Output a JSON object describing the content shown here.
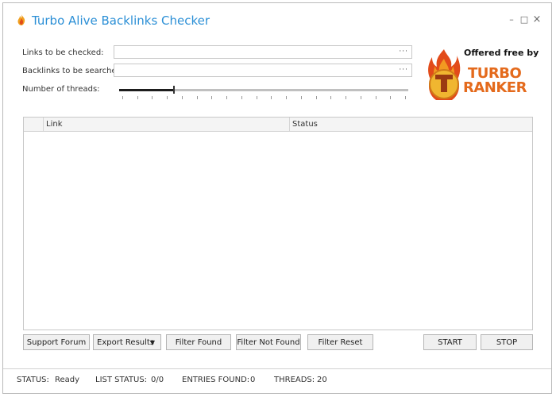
{
  "window": {
    "title": "Turbo Alive Backlinks Checker",
    "controls": {
      "minimize": "–",
      "maximize": "□",
      "close": "×"
    }
  },
  "form": {
    "links_label": "Links to be checked:",
    "links_value": "",
    "links_browse": "···",
    "backlinks_label": "Backlinks to be searched:",
    "backlinks_value": "",
    "backlinks_browse": "···",
    "threads_label": "Number of threads:",
    "threads_slider_value": 20,
    "threads_slider_fraction": 0.19
  },
  "logo": {
    "offered": "Offered free by",
    "turbo": "TURBO",
    "ranker": "RANKER",
    "flame_color": "#e24b1a",
    "accent_color": "#f29a21"
  },
  "table": {
    "columns": [
      "",
      "Link",
      "Status"
    ],
    "rows": []
  },
  "buttons": {
    "support_forum": "Support Forum",
    "export_results": "Export Results",
    "export_caret": "▼",
    "filter_found": "Filter Found",
    "filter_not_found": "Filter Not Found",
    "filter_reset": "Filter Reset",
    "start": "START",
    "stop": "STOP"
  },
  "status": {
    "status_label": "STATUS:",
    "status_value": "Ready",
    "list_label": "LIST STATUS:",
    "list_value": "0/0",
    "entries_label": "ENTRIES FOUND:",
    "entries_value": "0",
    "threads_label": "THREADS:",
    "threads_value": "20"
  }
}
